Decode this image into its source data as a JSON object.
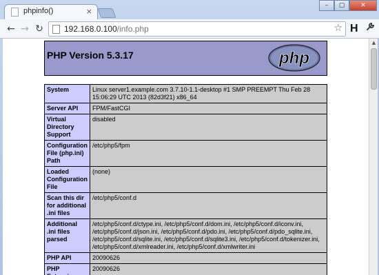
{
  "browser": {
    "tab_title": "phpinfo()",
    "tab_close": "×",
    "window_buttons": [
      "–",
      "▢",
      "✕"
    ],
    "url_host": "192.168.0.100",
    "url_path": "/info.php",
    "back_icon": "←",
    "forward_icon": "→",
    "reload_icon": "↻",
    "star_icon": "☆",
    "extension_label": "H",
    "wrench_icon": "🔧"
  },
  "page": {
    "title": "PHP Version 5.3.17",
    "logo_text": "php",
    "rows": [
      {
        "key": "System",
        "value": "Linux server1.example.com 3.7.10-1.1-desktop #1 SMP PREEMPT Thu Feb 28 15:06:29 UTC 2013 (82d3f21) x86_64"
      },
      {
        "key": "Server API",
        "value": "FPM/FastCGI"
      },
      {
        "key": "Virtual Directory Support",
        "value": "disabled"
      },
      {
        "key": "Configuration File (php.ini) Path",
        "value": "/etc/php5/fpm"
      },
      {
        "key": "Loaded Configuration File",
        "value": "(none)"
      },
      {
        "key": "Scan this dir for additional .ini files",
        "value": "/etc/php5/conf.d"
      },
      {
        "key": "Additional .ini files parsed",
        "value": "/etc/php5/conf.d/ctype.ini, /etc/php5/conf.d/dom.ini, /etc/php5/conf.d/iconv.ini, /etc/php5/conf.d/json.ini, /etc/php5/conf.d/pdo.ini, /etc/php5/conf.d/pdo_sqlite.ini, /etc/php5/conf.d/sqlite.ini, /etc/php5/conf.d/sqlite3.ini, /etc/php5/conf.d/tokenizer.ini, /etc/php5/conf.d/xmlreader.ini, /etc/php5/conf.d/xmlwriter.ini"
      },
      {
        "key": "PHP API",
        "value": "20090626"
      },
      {
        "key": "PHP Extension",
        "value": "20090626"
      }
    ]
  }
}
